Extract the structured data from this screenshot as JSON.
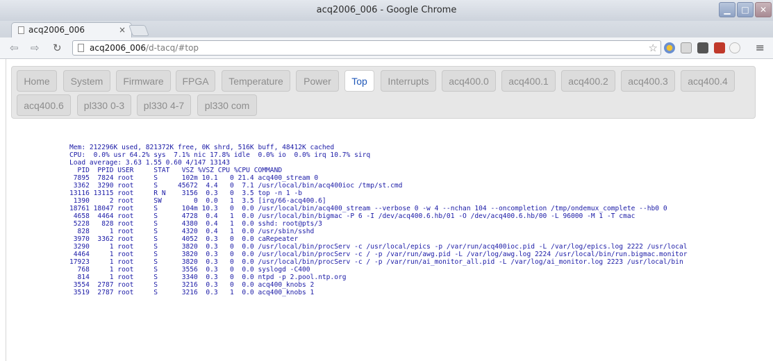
{
  "window": {
    "title": "acq2006_006 - Google Chrome",
    "buttons": [
      "minimize",
      "maximize",
      "close"
    ]
  },
  "browser": {
    "tab": {
      "label": "acq2006_006",
      "close": "×"
    },
    "toolbar": {
      "back": "⇦",
      "forward": "⇨",
      "reload": "↻",
      "url_host": "acq2006_006",
      "url_path": "/d-tacq/#top",
      "star": "☆",
      "menu": "≡"
    }
  },
  "nav": {
    "tabs": [
      {
        "label": "Home"
      },
      {
        "label": "System"
      },
      {
        "label": "Firmware"
      },
      {
        "label": "FPGA"
      },
      {
        "label": "Temperature"
      },
      {
        "label": "Power"
      },
      {
        "label": "Top",
        "active": true
      },
      {
        "label": "Interrupts"
      },
      {
        "label": "acq400.0"
      },
      {
        "label": "acq400.1"
      },
      {
        "label": "acq400.2"
      },
      {
        "label": "acq400.3"
      },
      {
        "label": "acq400.4"
      },
      {
        "label": "acq400.6"
      },
      {
        "label": "pl330 0-3"
      },
      {
        "label": "pl330 4-7"
      },
      {
        "label": "pl330 com"
      }
    ]
  },
  "top": {
    "lines": [
      "Mem: 212296K used, 821372K free, 0K shrd, 516K buff, 48412K cached",
      "CPU:  0.0% usr 64.2% sys  7.1% nic 17.8% idle  0.0% io  0.0% irq 10.7% sirq",
      "Load average: 3.63 1.55 0.60 4/147 13143",
      "  PID  PPID USER     STAT   VSZ %VSZ CPU %CPU COMMAND",
      " 7895  7824 root     S      102m 10.1   0 21.4 acq400_stream 0",
      " 3362  3290 root     S     45672  4.4   0  7.1 /usr/local/bin/acq400ioc /tmp/st.cmd",
      "13116 13115 root     R N    3156  0.3   0  3.5 top -n 1 -b",
      " 1390     2 root     SW        0  0.0   1  3.5 [irq/66-acq400.6]",
      "18761 18047 root     S      104m 10.3   0  0.0 /usr/local/bin/acq400_stream --verbose 0 -w 4 --nchan 104 --oncompletion /tmp/ondemux_complete --hb0 0",
      " 4658  4464 root     S      4728  0.4   1  0.0 /usr/local/bin/bigmac -P 6 -I /dev/acq400.6.hb/01 -O /dev/acq400.6.hb/00 -L 96000 -M 1 -T cmac",
      " 5228   828 root     S      4380  0.4   1  0.0 sshd: root@pts/3",
      "  828     1 root     S      4320  0.4   1  0.0 /usr/sbin/sshd",
      " 3970  3362 root     S      4052  0.3   0  0.0 caRepeater",
      " 3290     1 root     S      3820  0.3   0  0.0 /usr/local/bin/procServ -c /usr/local/epics -p /var/run/acq400ioc.pid -L /var/log/epics.log 2222 /usr/local",
      " 4464     1 root     S      3820  0.3   0  0.0 /usr/local/bin/procServ -c / -p /var/run/awg.pid -L /var/log/awg.log 2224 /usr/local/bin/run.bigmac.monitor",
      "17923     1 root     S      3820  0.3   0  0.0 /usr/local/bin/procServ -c / -p /var/run/ai_monitor_all.pid -L /var/log/ai_monitor.log 2223 /usr/local/bin",
      "  768     1 root     S      3556  0.3   0  0.0 syslogd -C400",
      "  814     1 root     S      3340  0.3   0  0.0 ntpd -p 2.pool.ntp.org",
      " 3554  2787 root     S      3216  0.3   0  0.0 acq400_knobs 2",
      " 3519  2787 root     S      3216  0.3   1  0.0 acq400_knobs 1"
    ]
  },
  "colors": {
    "accent": "#1f57b8",
    "terminal_text": "#1a1aa6",
    "tab_bg": "#dcdcdc"
  }
}
